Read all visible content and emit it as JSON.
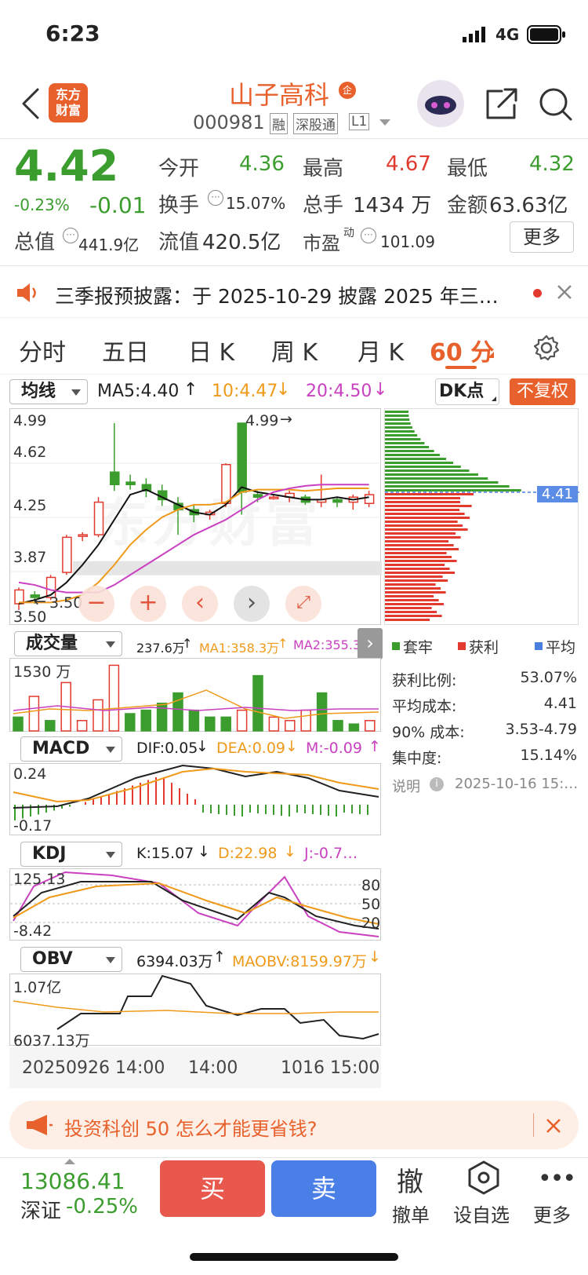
{
  "status_bar": {
    "time": "6:23",
    "network": "4G"
  },
  "header": {
    "logo_line1": "东方",
    "logo_line2": "财富",
    "stock_name": "山子高科",
    "badge": "企",
    "code": "000981",
    "tags": [
      "融",
      "深股通",
      "L1"
    ]
  },
  "quote": {
    "price": "4.42",
    "change_pct": "-0.23%",
    "change": "-0.01",
    "open_label": "今开",
    "open": "4.36",
    "high_label": "最高",
    "high": "4.67",
    "low_label": "最低",
    "low": "4.32",
    "turnover_label": "换手",
    "turnover": "15.07%",
    "volume_label": "总手",
    "volume": "1434 万",
    "amount_label": "金额",
    "amount": "63.63亿",
    "mcap_label": "总值",
    "mcap": "441.9亿",
    "float_label": "流值",
    "float_cap": "420.5亿",
    "pe_label": "市盈",
    "pe_sup": "动",
    "pe": "101.09",
    "more": "更多"
  },
  "notice": {
    "text": "三季报预披露：于 2025-10-29 披露 2025 年三…"
  },
  "tabs": [
    "分时",
    "五日",
    "日 K",
    "周 K",
    "月 K",
    "60 分"
  ],
  "active_tab": 5,
  "ma": {
    "selector": "均线",
    "ma5": "MA5:4.40",
    "ma10": "10:4.47",
    "ma20": "20:4.50",
    "dk": "DK点",
    "fq": "不复权"
  },
  "kline": {
    "y_labels": [
      "4.99",
      "4.62",
      "4.25",
      "3.87",
      "3.50"
    ],
    "max_marker": "4.99",
    "min_marker": "3.50",
    "price_tag": "4.41",
    "watermark": "东方财富"
  },
  "volume": {
    "selector": "成交量",
    "value": "237.6万",
    "ma1": "MA1:358.3万",
    "ma2": "MA2:355.3…",
    "y_top": "1530 万"
  },
  "macd": {
    "selector": "MACD",
    "dif": "DIF:0.05",
    "dea": "DEA:0.09",
    "m": "M:-0.09",
    "y_top": "0.24",
    "y_bottom": "-0.17"
  },
  "kdj": {
    "selector": "KDJ",
    "k": "K:15.07",
    "d": "D:22.98",
    "j": "J:-0.7…",
    "y_top": "125.13",
    "y_bottom": "-8.42",
    "levels": [
      "80",
      "50",
      "20"
    ]
  },
  "obv": {
    "selector": "OBV",
    "value": "6394.03万",
    "ma": "MAOBV:8159.97万",
    "y_top": "1.07亿",
    "y_bottom": "6037.13万"
  },
  "time_axis": [
    "20250926 14:00",
    "14:00",
    "1016 15:00"
  ],
  "chips": {
    "legend": [
      "套牢",
      "获利",
      "平均"
    ],
    "stats": [
      {
        "label": "获利比例:",
        "value": "53.07%"
      },
      {
        "label": "平均成本:",
        "value": "4.41"
      },
      {
        "label": "90% 成本:",
        "value": "3.53-4.79"
      },
      {
        "label": "集中度:",
        "value": "15.14%"
      }
    ],
    "note_label": "说明",
    "note_time": "2025-10-16 15:…"
  },
  "ad": {
    "text": "投资科创 50 怎么才能更省钱?"
  },
  "bottom": {
    "index_value": "13086.41",
    "index_name": "深证",
    "index_change": "-0.25%",
    "buy": "买",
    "sell": "卖",
    "cancel_glyph": "撤",
    "cancel": "撤单",
    "watch": "设自选",
    "more": "更多"
  },
  "colors": {
    "up": "#e23a2e",
    "down": "#3c9d2f",
    "accent": "#e8612c",
    "ma10": "#ef9a1a",
    "ma20": "#c940c0"
  }
}
